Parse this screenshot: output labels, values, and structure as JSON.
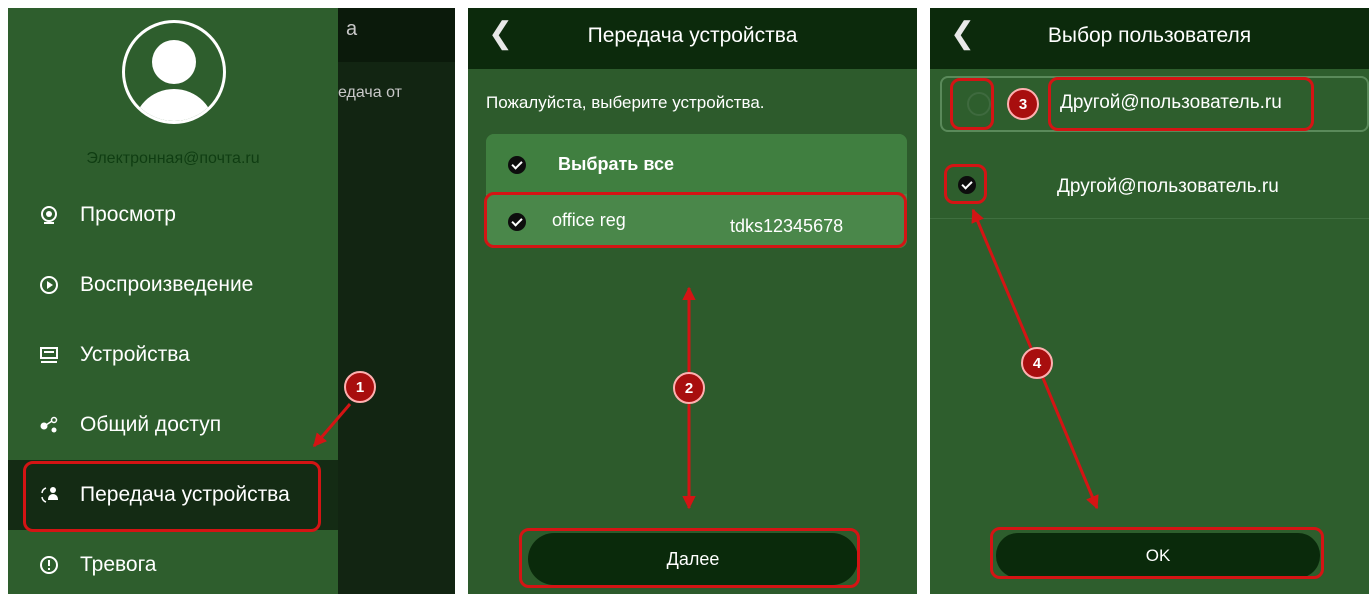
{
  "panel1": {
    "background_title_fragment": "а",
    "background_text_fragment": "едача от",
    "email": "Электронная@почта.ru",
    "menu": [
      {
        "label": "Просмотр",
        "icon": "camera-icon"
      },
      {
        "label": "Воспроизведение",
        "icon": "play-circle-icon"
      },
      {
        "label": "Устройства",
        "icon": "device-list-icon"
      },
      {
        "label": "Общий доступ",
        "icon": "share-icon"
      },
      {
        "label": "Передача устройства",
        "icon": "transfer-users-icon",
        "active": true
      },
      {
        "label": "Тревога",
        "icon": "alert-icon"
      }
    ]
  },
  "panel2": {
    "title": "Передача устройства",
    "prompt": "Пожалуйста, выберите устройства.",
    "select_all": "Выбрать все",
    "device": {
      "name": "office reg",
      "serial": "tdks12345678"
    },
    "next_button": "Далее"
  },
  "panel3": {
    "title": "Выбор пользователя",
    "user_1": "Другой@пользователь.ru",
    "user_2": "Другой@пользователь.ru",
    "ok_button": "OK"
  },
  "annotations": {
    "step_1": "1",
    "step_2": "2",
    "step_3": "3",
    "step_4": "4"
  },
  "colors": {
    "panel_bg": "#2e5e2d",
    "header_bg": "#0c2a0c",
    "highlight": "#d41414"
  }
}
